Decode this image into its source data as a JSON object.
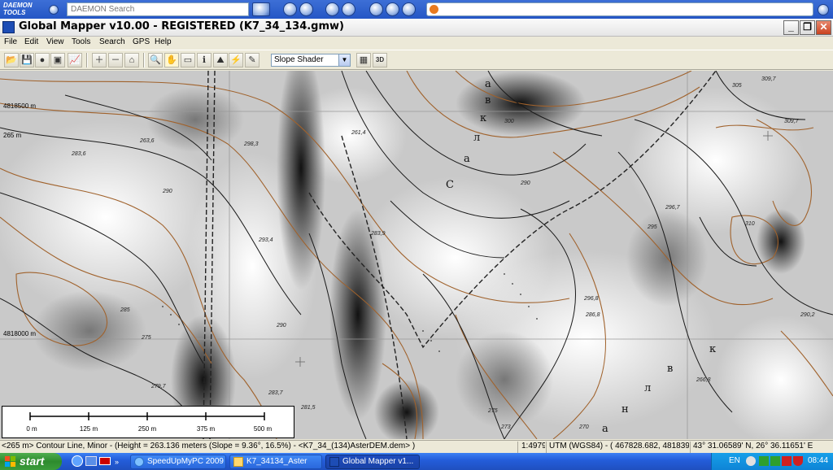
{
  "daemon_toolbar": {
    "logo_text": "DAEMON TOOLS",
    "search_placeholder": "DAEMON Search"
  },
  "window": {
    "title": "Global Mapper v10.00 - REGISTERED (K7_34_134.gmw)",
    "controls": [
      "minimize",
      "restore",
      "close"
    ]
  },
  "menu": [
    "File",
    "Edit",
    "View",
    "Tools",
    "Search",
    "GPS",
    "Help"
  ],
  "toolbar": {
    "shader_selected": "Slope Shader",
    "buttons": [
      {
        "name": "open-icon",
        "glyph": "📂"
      },
      {
        "name": "save-icon",
        "glyph": "💾"
      },
      {
        "name": "globe-icon",
        "glyph": "●"
      },
      {
        "name": "overlay-icon",
        "glyph": "▣"
      },
      {
        "name": "chart-icon",
        "glyph": "📈"
      },
      {
        "name": "zoom-in-icon",
        "glyph": "＋"
      },
      {
        "name": "zoom-out-icon",
        "glyph": "－"
      },
      {
        "name": "home-icon",
        "glyph": "⌂"
      },
      {
        "name": "search-icon",
        "glyph": "🔍"
      },
      {
        "name": "pan-hand-icon",
        "glyph": "✋"
      },
      {
        "name": "measure-icon",
        "glyph": "▭"
      },
      {
        "name": "info-icon",
        "glyph": "ℹ"
      },
      {
        "name": "path-profile-icon",
        "glyph": "⛰"
      },
      {
        "name": "tower-icon",
        "glyph": "⚡"
      },
      {
        "name": "digitizer-icon",
        "glyph": "✎"
      }
    ],
    "right_buttons": [
      {
        "name": "shader-image-icon",
        "glyph": "▦"
      },
      {
        "name": "3d-view-icon",
        "glyph": "3D"
      }
    ]
  },
  "map": {
    "grid_labels": [
      {
        "text": "4818500 m"
      },
      {
        "text": "265 m"
      },
      {
        "text": "4818000 m"
      }
    ],
    "contour_labels": [
      "263,6",
      "298,3",
      "261,4",
      "300",
      "305",
      "309,7",
      "309,7",
      "283,6",
      "290",
      "293,4",
      "283,9",
      "296,7",
      "310",
      "295",
      "290",
      "285",
      "275",
      "290",
      "279,7",
      "283,7",
      "281,5",
      "266,8",
      "275",
      "273",
      "270",
      "296,8",
      "286,8",
      "290,2"
    ],
    "cyrillic_labels": [
      "С",
      "а",
      "л",
      "к",
      "в",
      "а",
      "к",
      "в",
      "л",
      "н",
      "а"
    ]
  },
  "scale_bar": {
    "ticks": [
      "0 m",
      "125 m",
      "250 m",
      "375 m",
      "500 m"
    ]
  },
  "status": {
    "feature_info": "<265 m> Contour Line, Minor - (Height = 263.136 meters (Slope = 9.36°, 16.5%) - <K7_34_(134)AsterDEM.dem> )",
    "scale": "1:4979",
    "projection": "UTM (WGS84) - ( 467828.682, 4818391.266 )",
    "latlon": "43° 31.06589' N, 26° 36.11651' E"
  },
  "taskbar": {
    "start_label": "start",
    "tasks": [
      {
        "label": "SpeedUpMyPC 2009",
        "active": false
      },
      {
        "label": "K7_34134_Aster",
        "active": false
      },
      {
        "label": "Global Mapper v1...",
        "active": true
      }
    ],
    "language": "EN",
    "clock": "08:44"
  }
}
